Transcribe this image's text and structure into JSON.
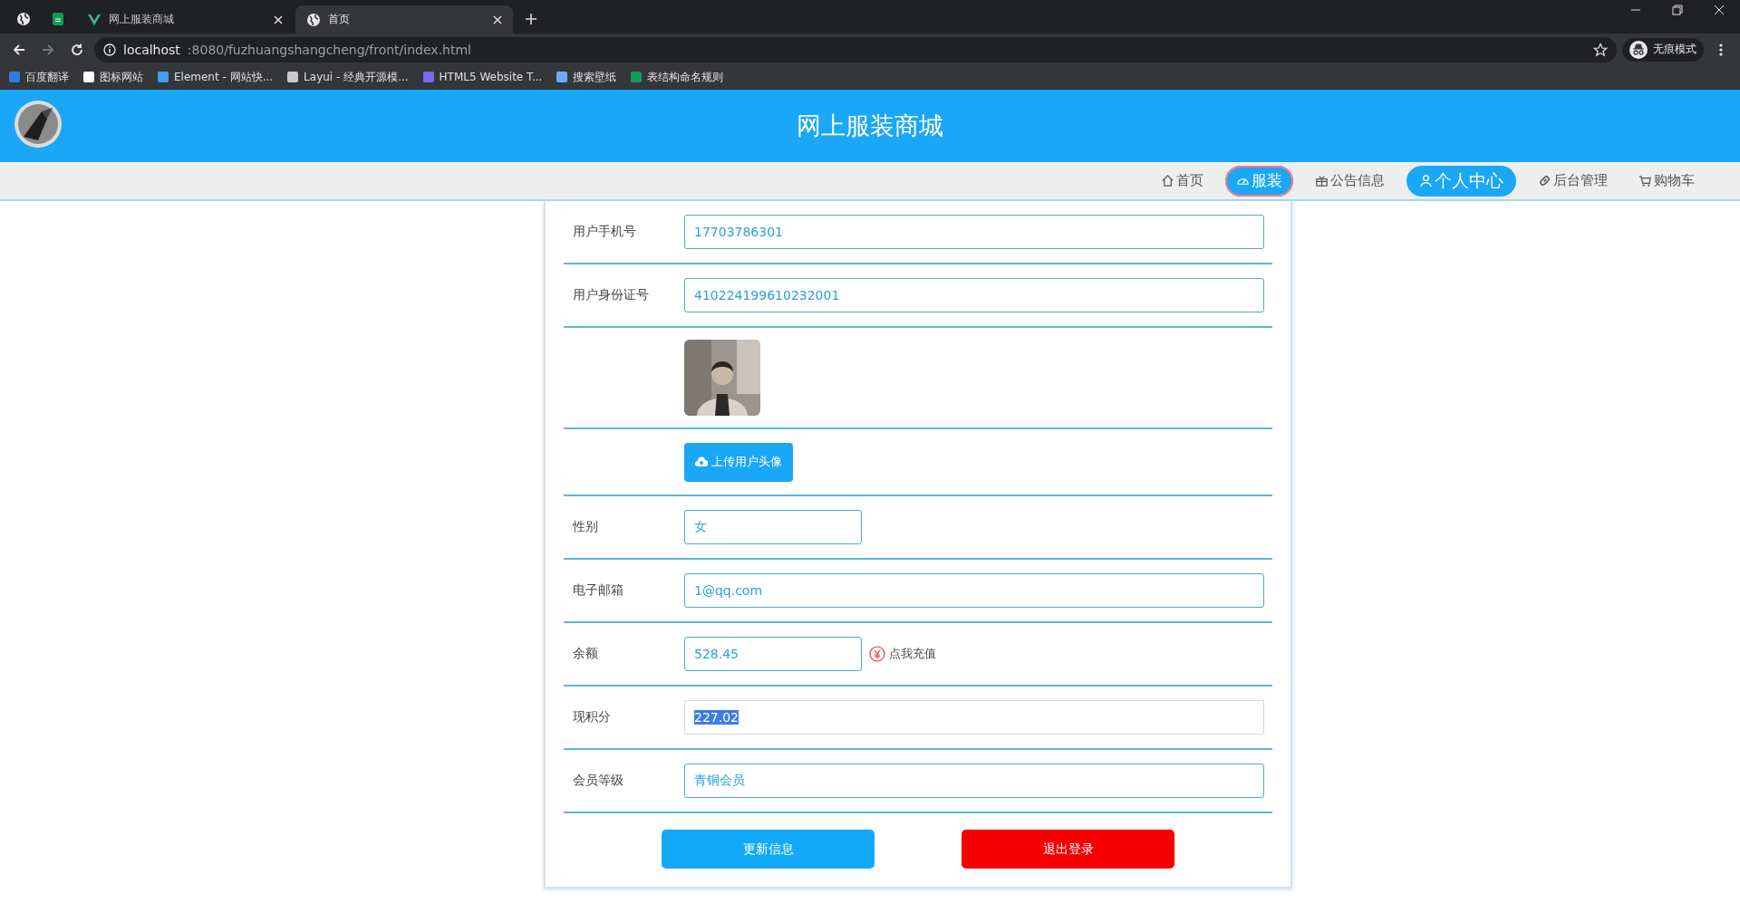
{
  "browser": {
    "tabs": [
      {
        "title": "网上服装商城",
        "selected": false
      },
      {
        "title": "首页",
        "selected": true
      }
    ],
    "url": {
      "host": "localhost",
      "path": ":8080/fuzhuangshangcheng/front/index.html"
    },
    "incognito_label": "无痕模式",
    "bookmarks": [
      {
        "label": "百度翻译",
        "color": "#2f7de1"
      },
      {
        "label": "图标网站",
        "color": "#ffffff"
      },
      {
        "label": "Element - 网站快...",
        "color": "#409eff"
      },
      {
        "label": "Layui - 经典开源模...",
        "color": "#c9c9c9"
      },
      {
        "label": "HTML5 Website T...",
        "color": "#7b68ee"
      },
      {
        "label": "搜索壁纸",
        "color": "#6ea8ff"
      },
      {
        "label": "表结构命名规则",
        "color": "#0f9d58"
      }
    ]
  },
  "header": {
    "title": "网上服装商城"
  },
  "nav": [
    {
      "label": "首页",
      "kind": "home",
      "selected": false,
      "hovered": false
    },
    {
      "label": "服装",
      "kind": "gauge",
      "selected": false,
      "hovered": true
    },
    {
      "label": "公告信息",
      "kind": "gift",
      "selected": false,
      "hovered": false
    },
    {
      "label": "个人中心",
      "kind": "user",
      "selected": true,
      "hovered": false
    },
    {
      "label": "后台管理",
      "kind": "link",
      "selected": false,
      "hovered": false
    },
    {
      "label": "购物车",
      "kind": "cart",
      "selected": false,
      "hovered": false
    }
  ],
  "form": [
    {
      "kind": "text",
      "label": "用户手机号",
      "value": "17703786301",
      "text_selected": false
    },
    {
      "kind": "text",
      "label": "用户身份证号",
      "value": "410224199610232001",
      "text_selected": false
    },
    {
      "kind": "avatar"
    },
    {
      "kind": "upload",
      "button": "上传用户头像"
    },
    {
      "kind": "select",
      "label": "性别",
      "value": "女"
    },
    {
      "kind": "text",
      "label": "电子邮箱",
      "value": "1@qq.com",
      "text_selected": false
    },
    {
      "kind": "balance",
      "label": "余额",
      "value": "528.45",
      "link": "点我充值"
    },
    {
      "kind": "text",
      "label": "现积分",
      "value": "227.02",
      "text_selected": true
    },
    {
      "kind": "text",
      "label": "会员等级",
      "value": "青铜会员",
      "text_selected": false
    }
  ],
  "buttons": [
    {
      "kind": "primary",
      "label": "更新信息"
    },
    {
      "kind": "danger",
      "label": "退出登录"
    }
  ]
}
